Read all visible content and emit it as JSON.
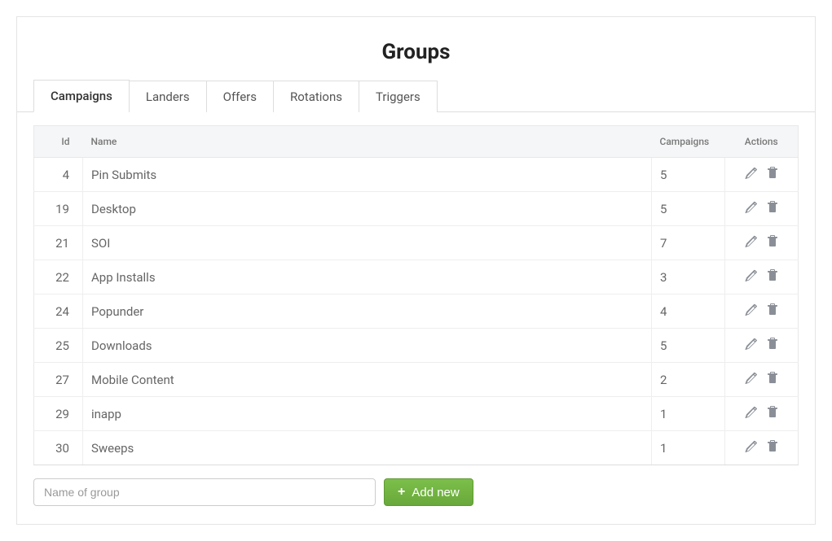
{
  "title": "Groups",
  "tabs": [
    {
      "label": "Campaigns",
      "active": true
    },
    {
      "label": "Landers",
      "active": false
    },
    {
      "label": "Offers",
      "active": false
    },
    {
      "label": "Rotations",
      "active": false
    },
    {
      "label": "Triggers",
      "active": false
    }
  ],
  "table": {
    "headers": {
      "id": "Id",
      "name": "Name",
      "campaigns": "Campaigns",
      "actions": "Actions"
    },
    "rows": [
      {
        "id": 4,
        "name": "Pin Submits",
        "campaigns": 5
      },
      {
        "id": 19,
        "name": "Desktop",
        "campaigns": 5
      },
      {
        "id": 21,
        "name": "SOI",
        "campaigns": 7
      },
      {
        "id": 22,
        "name": "App Installs",
        "campaigns": 3
      },
      {
        "id": 24,
        "name": "Popunder",
        "campaigns": 4
      },
      {
        "id": 25,
        "name": "Downloads",
        "campaigns": 5
      },
      {
        "id": 27,
        "name": "Mobile Content",
        "campaigns": 2
      },
      {
        "id": 29,
        "name": "inapp",
        "campaigns": 1
      },
      {
        "id": 30,
        "name": "Sweeps",
        "campaigns": 1
      }
    ]
  },
  "footer": {
    "input_placeholder": "Name of group",
    "add_button_label": "Add new"
  }
}
